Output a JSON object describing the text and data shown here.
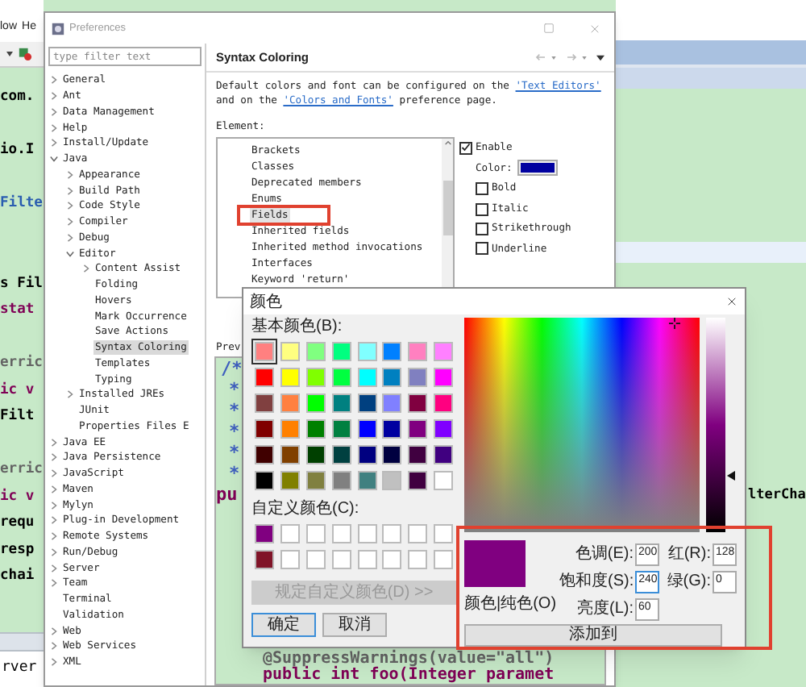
{
  "editor": {
    "menu": [
      "low",
      "He"
    ],
    "code_left": [
      {
        "kind": "plain",
        "text": "com."
      },
      {
        "kind": "plain",
        "text": "io.I"
      },
      {
        "kind": "type",
        "text": "Filte"
      },
      {
        "kind": "plain",
        "text": "s Fil"
      },
      {
        "kind": "keyword",
        "text": "stat"
      },
      {
        "kind": "annotation",
        "text": "erric"
      },
      {
        "kind": "keyword",
        "text": "ic v"
      },
      {
        "kind": "plain",
        "text": "Filt"
      },
      {
        "kind": "annotation",
        "text": "erric"
      },
      {
        "kind": "keyword",
        "text": "ic v"
      },
      {
        "kind": "plain",
        "text": "requ"
      },
      {
        "kind": "plain",
        "text": "resp"
      },
      {
        "kind": "plain",
        "text": "chai"
      }
    ],
    "code_right": "lterCha",
    "bottom_tab": "rver"
  },
  "preferences": {
    "title": "Preferences",
    "filter": {
      "placeholder": "type filter text"
    },
    "tree": [
      {
        "label": "General",
        "kind": "branch",
        "expanded": false,
        "selected": false
      },
      {
        "label": "Ant",
        "kind": "branch",
        "expanded": false,
        "selected": false
      },
      {
        "label": "Data Management",
        "kind": "branch",
        "expanded": false,
        "selected": false
      },
      {
        "label": "Help",
        "kind": "branch",
        "expanded": false,
        "selected": false
      },
      {
        "label": "Install/Update",
        "kind": "branch",
        "expanded": false,
        "selected": false
      },
      {
        "label": "Java",
        "kind": "branch",
        "expanded": true,
        "selected": false,
        "children": [
          {
            "label": "Appearance",
            "kind": "branch",
            "expanded": false,
            "selected": false
          },
          {
            "label": "Build Path",
            "kind": "branch",
            "expanded": false,
            "selected": false
          },
          {
            "label": "Code Style",
            "kind": "branch",
            "expanded": false,
            "selected": false
          },
          {
            "label": "Compiler",
            "kind": "branch",
            "expanded": false,
            "selected": false
          },
          {
            "label": "Debug",
            "kind": "branch",
            "expanded": false,
            "selected": false
          },
          {
            "label": "Editor",
            "kind": "branch",
            "expanded": true,
            "selected": false,
            "children": [
              {
                "label": "Content Assist",
                "kind": "branch",
                "expanded": false,
                "selected": false
              },
              {
                "label": "Folding",
                "kind": "leaf",
                "selected": false
              },
              {
                "label": "Hovers",
                "kind": "leaf",
                "selected": false
              },
              {
                "label": "Mark Occurrence",
                "kind": "leaf",
                "selected": false
              },
              {
                "label": "Save Actions",
                "kind": "leaf",
                "selected": false
              },
              {
                "label": "Syntax Coloring",
                "kind": "leaf",
                "selected": true
              },
              {
                "label": "Templates",
                "kind": "leaf",
                "selected": false
              },
              {
                "label": "Typing",
                "kind": "leaf",
                "selected": false
              }
            ]
          },
          {
            "label": "Installed JREs",
            "kind": "branch",
            "expanded": false,
            "selected": false
          },
          {
            "label": "JUnit",
            "kind": "leaf",
            "selected": false
          },
          {
            "label": "Properties Files E",
            "kind": "leaf",
            "selected": false
          }
        ]
      },
      {
        "label": "Java EE",
        "kind": "branch",
        "expanded": false,
        "selected": false
      },
      {
        "label": "Java Persistence",
        "kind": "branch",
        "expanded": false,
        "selected": false
      },
      {
        "label": "JavaScript",
        "kind": "branch",
        "expanded": false,
        "selected": false
      },
      {
        "label": "Maven",
        "kind": "branch",
        "expanded": false,
        "selected": false
      },
      {
        "label": "Mylyn",
        "kind": "branch",
        "expanded": false,
        "selected": false
      },
      {
        "label": "Plug-in Development",
        "kind": "branch",
        "expanded": false,
        "selected": false
      },
      {
        "label": "Remote Systems",
        "kind": "branch",
        "expanded": false,
        "selected": false
      },
      {
        "label": "Run/Debug",
        "kind": "branch",
        "expanded": false,
        "selected": false
      },
      {
        "label": "Server",
        "kind": "branch",
        "expanded": false,
        "selected": false
      },
      {
        "label": "Team",
        "kind": "branch",
        "expanded": false,
        "selected": false
      },
      {
        "label": "Terminal",
        "kind": "leaf",
        "selected": false
      },
      {
        "label": "Validation",
        "kind": "leaf",
        "selected": false
      },
      {
        "label": "Web",
        "kind": "branch",
        "expanded": false,
        "selected": false
      },
      {
        "label": "Web Services",
        "kind": "branch",
        "expanded": false,
        "selected": false
      },
      {
        "label": "XML",
        "kind": "branch",
        "expanded": false,
        "selected": false
      }
    ],
    "page": {
      "title": "Syntax Coloring",
      "description": [
        {
          "kind": "text",
          "text": "Default colors and font can be configured on the "
        },
        {
          "kind": "link",
          "text": "'Text Editors'"
        },
        {
          "kind": "text",
          "text": " and on the "
        },
        {
          "kind": "link",
          "text": "'Colors and Fonts'"
        },
        {
          "kind": "text",
          "text": " preference page."
        }
      ],
      "element_label": "Element:",
      "elements": [
        {
          "label": "Brackets",
          "selected": false
        },
        {
          "label": "Classes",
          "selected": false
        },
        {
          "label": "Deprecated members",
          "selected": false
        },
        {
          "label": "Enums",
          "selected": false
        },
        {
          "label": "Fields",
          "selected": true
        },
        {
          "label": "Inherited fields",
          "selected": false
        },
        {
          "label": "Inherited method invocations",
          "selected": false
        },
        {
          "label": "Interfaces",
          "selected": false
        },
        {
          "label": "Keyword 'return'",
          "selected": false
        }
      ],
      "enable": {
        "label": "Enable",
        "checked": true
      },
      "color": {
        "label": "Color:"
      },
      "styles": [
        {
          "label": "Bold",
          "checked": false
        },
        {
          "label": "Italic",
          "checked": false
        },
        {
          "label": "Strikethrough",
          "checked": false
        },
        {
          "label": "Underline",
          "checked": false
        }
      ],
      "preview_label": "Prev",
      "preview_lines": [
        {
          "kind": "comment",
          "text": "/*"
        },
        {
          "kind": "star",
          "text": "*"
        },
        {
          "kind": "star",
          "text": "*"
        },
        {
          "kind": "star",
          "text": "*"
        },
        {
          "kind": "star",
          "text": "*"
        },
        {
          "kind": "star",
          "text": "*"
        },
        {
          "kind": "keyword",
          "text": "pu"
        }
      ],
      "preview_bottom": [
        {
          "kind": "annotation",
          "text": "@SuppressWarnings(value=\"all\")"
        },
        {
          "kind": "code",
          "text": "public int foo(Integer paramet"
        }
      ]
    }
  },
  "color_dialog": {
    "title": "颜色",
    "basic_label": "基本颜色(B):",
    "basic_colors": [
      {
        "color": "#ff8080",
        "selected": true
      },
      {
        "color": "#ffff80",
        "selected": false
      },
      {
        "color": "#80ff80",
        "selected": false
      },
      {
        "color": "#00ff80",
        "selected": false
      },
      {
        "color": "#80ffff",
        "selected": false
      },
      {
        "color": "#0080ff",
        "selected": false
      },
      {
        "color": "#ff80c0",
        "selected": false
      },
      {
        "color": "#ff80ff",
        "selected": false
      },
      {
        "color": "#ff0000",
        "selected": false
      },
      {
        "color": "#ffff00",
        "selected": false
      },
      {
        "color": "#80ff00",
        "selected": false
      },
      {
        "color": "#00ff40",
        "selected": false
      },
      {
        "color": "#00ffff",
        "selected": false
      },
      {
        "color": "#0080c0",
        "selected": false
      },
      {
        "color": "#8080c0",
        "selected": false
      },
      {
        "color": "#ff00ff",
        "selected": false
      },
      {
        "color": "#804040",
        "selected": false
      },
      {
        "color": "#ff8040",
        "selected": false
      },
      {
        "color": "#00ff00",
        "selected": false
      },
      {
        "color": "#008080",
        "selected": false
      },
      {
        "color": "#004080",
        "selected": false
      },
      {
        "color": "#8080ff",
        "selected": false
      },
      {
        "color": "#800040",
        "selected": false
      },
      {
        "color": "#ff0080",
        "selected": false
      },
      {
        "color": "#800000",
        "selected": false
      },
      {
        "color": "#ff8000",
        "selected": false
      },
      {
        "color": "#008000",
        "selected": false
      },
      {
        "color": "#008040",
        "selected": false
      },
      {
        "color": "#0000ff",
        "selected": false
      },
      {
        "color": "#0000a0",
        "selected": false
      },
      {
        "color": "#800080",
        "selected": false
      },
      {
        "color": "#8000ff",
        "selected": false
      },
      {
        "color": "#400000",
        "selected": false
      },
      {
        "color": "#804000",
        "selected": false
      },
      {
        "color": "#004000",
        "selected": false
      },
      {
        "color": "#004040",
        "selected": false
      },
      {
        "color": "#000080",
        "selected": false
      },
      {
        "color": "#000040",
        "selected": false
      },
      {
        "color": "#400040",
        "selected": false
      },
      {
        "color": "#400080",
        "selected": false
      },
      {
        "color": "#000000",
        "selected": false
      },
      {
        "color": "#808000",
        "selected": false
      },
      {
        "color": "#808040",
        "selected": false
      },
      {
        "color": "#808080",
        "selected": false
      },
      {
        "color": "#408080",
        "selected": false
      },
      {
        "color": "#c0c0c0",
        "selected": false
      },
      {
        "color": "#400040",
        "selected": false
      },
      {
        "color": "#ffffff",
        "selected": false
      }
    ],
    "custom_label": "自定义颜色(C):",
    "custom_colors": [
      {
        "color": "#800080"
      },
      {
        "color": "#ffffff"
      },
      {
        "color": "#ffffff"
      },
      {
        "color": "#ffffff"
      },
      {
        "color": "#ffffff"
      },
      {
        "color": "#ffffff"
      },
      {
        "color": "#ffffff"
      },
      {
        "color": "#ffffff"
      },
      {
        "color": "#801428"
      },
      {
        "color": "#ffffff"
      },
      {
        "color": "#ffffff"
      },
      {
        "color": "#ffffff"
      },
      {
        "color": "#ffffff"
      },
      {
        "color": "#ffffff"
      },
      {
        "color": "#ffffff"
      },
      {
        "color": "#ffffff"
      }
    ],
    "define_button": {
      "label": "规定自定义颜色(D) >>",
      "disabled": true
    },
    "ok_button": {
      "label": "确定",
      "default": true
    },
    "cancel_button": {
      "label": "取消",
      "default": false
    },
    "luminance": {
      "level": 0.26
    },
    "solid_label": "颜色|纯色(O)",
    "hsl_fields": [
      {
        "label": "色调(E):",
        "value": "200",
        "focused": false
      },
      {
        "label": "饱和度(S):",
        "value": "240",
        "focused": true
      },
      {
        "label": "亮度(L):",
        "value": "60",
        "focused": false
      }
    ],
    "rgb_fields": [
      {
        "label": "红(R):",
        "value": "128",
        "focused": false
      },
      {
        "label": "绿(G):",
        "value": "0",
        "focused": false
      }
    ],
    "add_button": {
      "label": "添加到"
    }
  }
}
